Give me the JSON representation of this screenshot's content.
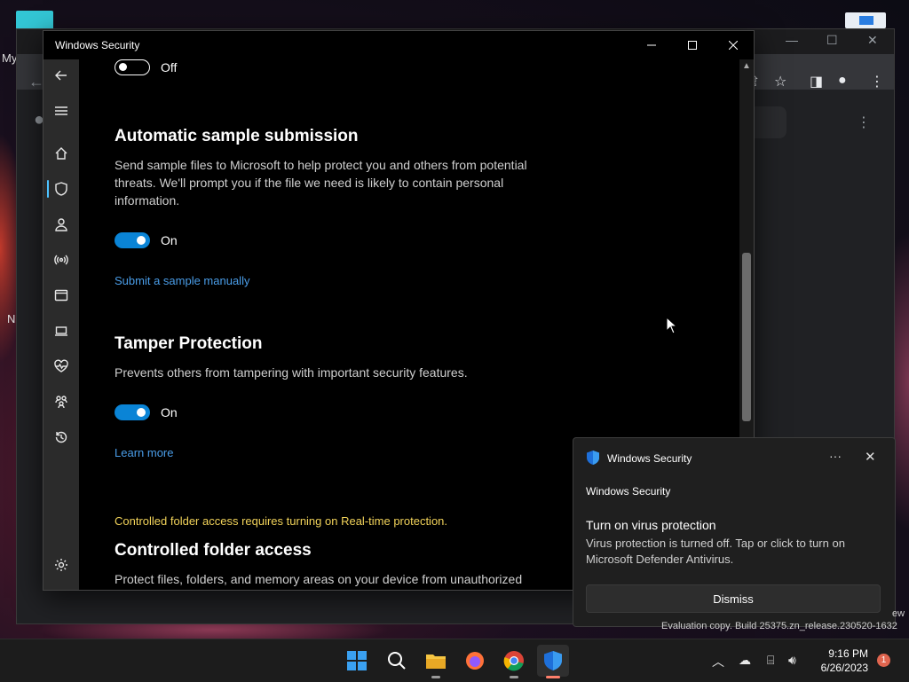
{
  "desktop": {
    "label_my": "My",
    "label_n": "N"
  },
  "window": {
    "title": "Windows Security",
    "minimize": "—",
    "maximize": "☐",
    "close": "✕"
  },
  "settings": {
    "top_toggle": {
      "state": "off",
      "label": "Off"
    },
    "sample_submission": {
      "title": "Automatic sample submission",
      "description": "Send sample files to Microsoft to help protect you and others from potential threats. We'll prompt you if the file we need is likely to contain personal information.",
      "toggle_state": "on",
      "toggle_label": "On",
      "link": "Submit a sample manually"
    },
    "tamper_protection": {
      "title": "Tamper Protection",
      "description": "Prevents others from tampering with important security features.",
      "toggle_state": "on",
      "toggle_label": "On",
      "link": "Learn more"
    },
    "controlled_folder": {
      "warning": "Controlled folder access requires turning on Real-time protection.",
      "title": "Controlled folder access",
      "description": "Protect files, folders, and memory areas on your device from unauthorized"
    }
  },
  "sidebar": {
    "items": [
      {
        "name": "back",
        "icon": "back-arrow-icon"
      },
      {
        "name": "menu",
        "icon": "hamburger-icon"
      },
      {
        "name": "home",
        "icon": "home-icon"
      },
      {
        "name": "virus-protection",
        "icon": "shield-icon",
        "active": true
      },
      {
        "name": "account-protection",
        "icon": "person-icon"
      },
      {
        "name": "firewall",
        "icon": "antenna-icon"
      },
      {
        "name": "app-browser-control",
        "icon": "browser-window-icon"
      },
      {
        "name": "device-security",
        "icon": "laptop-icon"
      },
      {
        "name": "device-performance",
        "icon": "heart-pulse-icon"
      },
      {
        "name": "family-options",
        "icon": "family-icon"
      },
      {
        "name": "protection-history",
        "icon": "history-icon"
      },
      {
        "name": "settings",
        "icon": "gear-icon"
      }
    ]
  },
  "toast": {
    "app_name": "Windows Security",
    "more": "···",
    "close": "✕",
    "sub_header": "Windows Security",
    "heading": "Turn on virus protection",
    "body": "Virus protection is turned off. Tap or click to turn on Microsoft Defender Antivirus.",
    "dismiss": "Dismiss"
  },
  "watermark": {
    "line1": "ew",
    "line2": "Evaluation copy. Build 25375.zn_release.230520-1632"
  },
  "taskbar": {
    "apps": [
      "start",
      "search",
      "file-explorer",
      "firefox",
      "chrome",
      "windows-security"
    ],
    "time": "9:16 PM",
    "date": "6/26/2023",
    "notification_count": "1",
    "colors": {
      "accent": "#0a84d6",
      "link": "#4a9de8",
      "warning": "#f2d35a"
    }
  }
}
